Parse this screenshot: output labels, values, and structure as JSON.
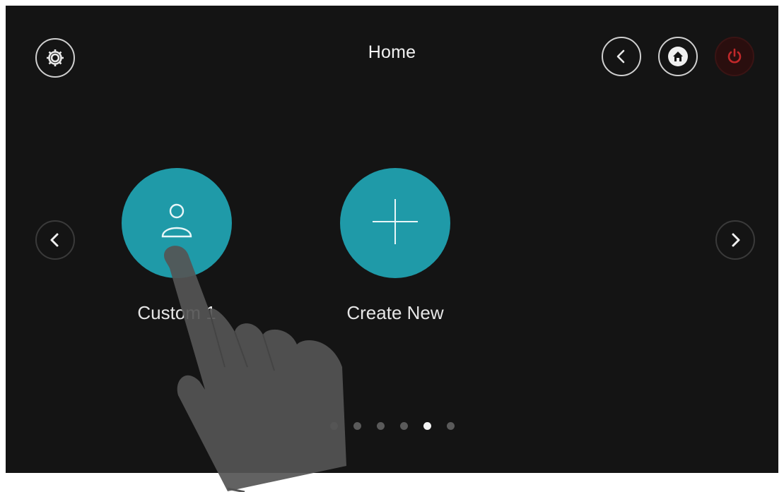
{
  "header": {
    "title": "Home"
  },
  "icons": {
    "settings": "gear-icon",
    "back": "chevron-left-icon",
    "home": "house-icon",
    "power": "power-icon",
    "prev": "chevron-left-icon",
    "next": "chevron-right-icon"
  },
  "tiles": [
    {
      "label": "Custom 1",
      "icon": "user-icon"
    },
    {
      "label": "Create New",
      "icon": "plus-icon"
    }
  ],
  "pagination": {
    "count": 6,
    "active_index": 4
  },
  "colors": {
    "background": "#141414",
    "accent": "#1f9aa8",
    "power": "#c0282a"
  }
}
